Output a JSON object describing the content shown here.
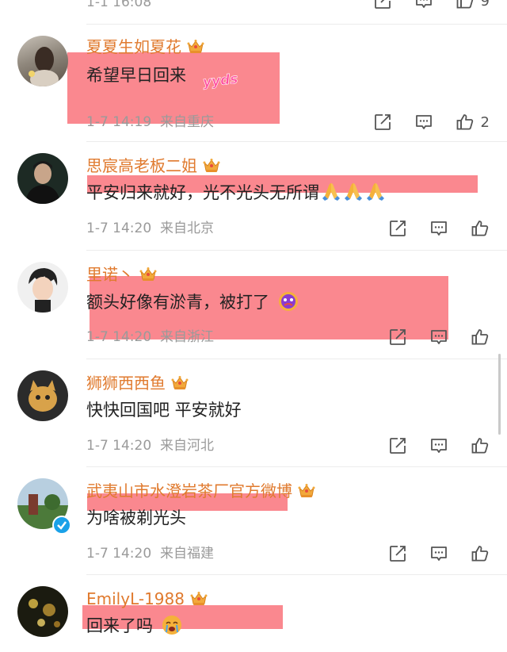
{
  "top_stub": {
    "meta": "1-1 16:08",
    "like_count": "9"
  },
  "comments": [
    {
      "username": "夏夏生如夏花",
      "text": "希望早日回来",
      "sticker": "yyds",
      "time": "1-7 14:19",
      "location": "来自重庆",
      "like_count": "2"
    },
    {
      "username": "思宸高老板二姐",
      "text": "平安归来就好，光不光头无所谓",
      "time": "1-7 14:20",
      "location": "来自北京",
      "like_count": ""
    },
    {
      "username": "里诺丶",
      "text": "额头好像有淤青，被打了",
      "time": "1-7 14:20",
      "location": "来自浙江",
      "like_count": ""
    },
    {
      "username": "狮狮西西鱼",
      "text": "快快回国吧 平安就好",
      "time": "1-7 14:20",
      "location": "来自河北",
      "like_count": ""
    },
    {
      "username": "武夷山市水澄岩茶厂官方微博",
      "text": "为啥被剃光头",
      "time": "1-7 14:20",
      "location": "来自福建",
      "like_count": ""
    },
    {
      "username": "EmilyL-1988",
      "text": "回来了吗",
      "time": "",
      "location": "",
      "like_count": ""
    }
  ],
  "colors": {
    "username": "#e07a2e",
    "highlight": "#f86670",
    "meta": "#9a9a9a"
  }
}
